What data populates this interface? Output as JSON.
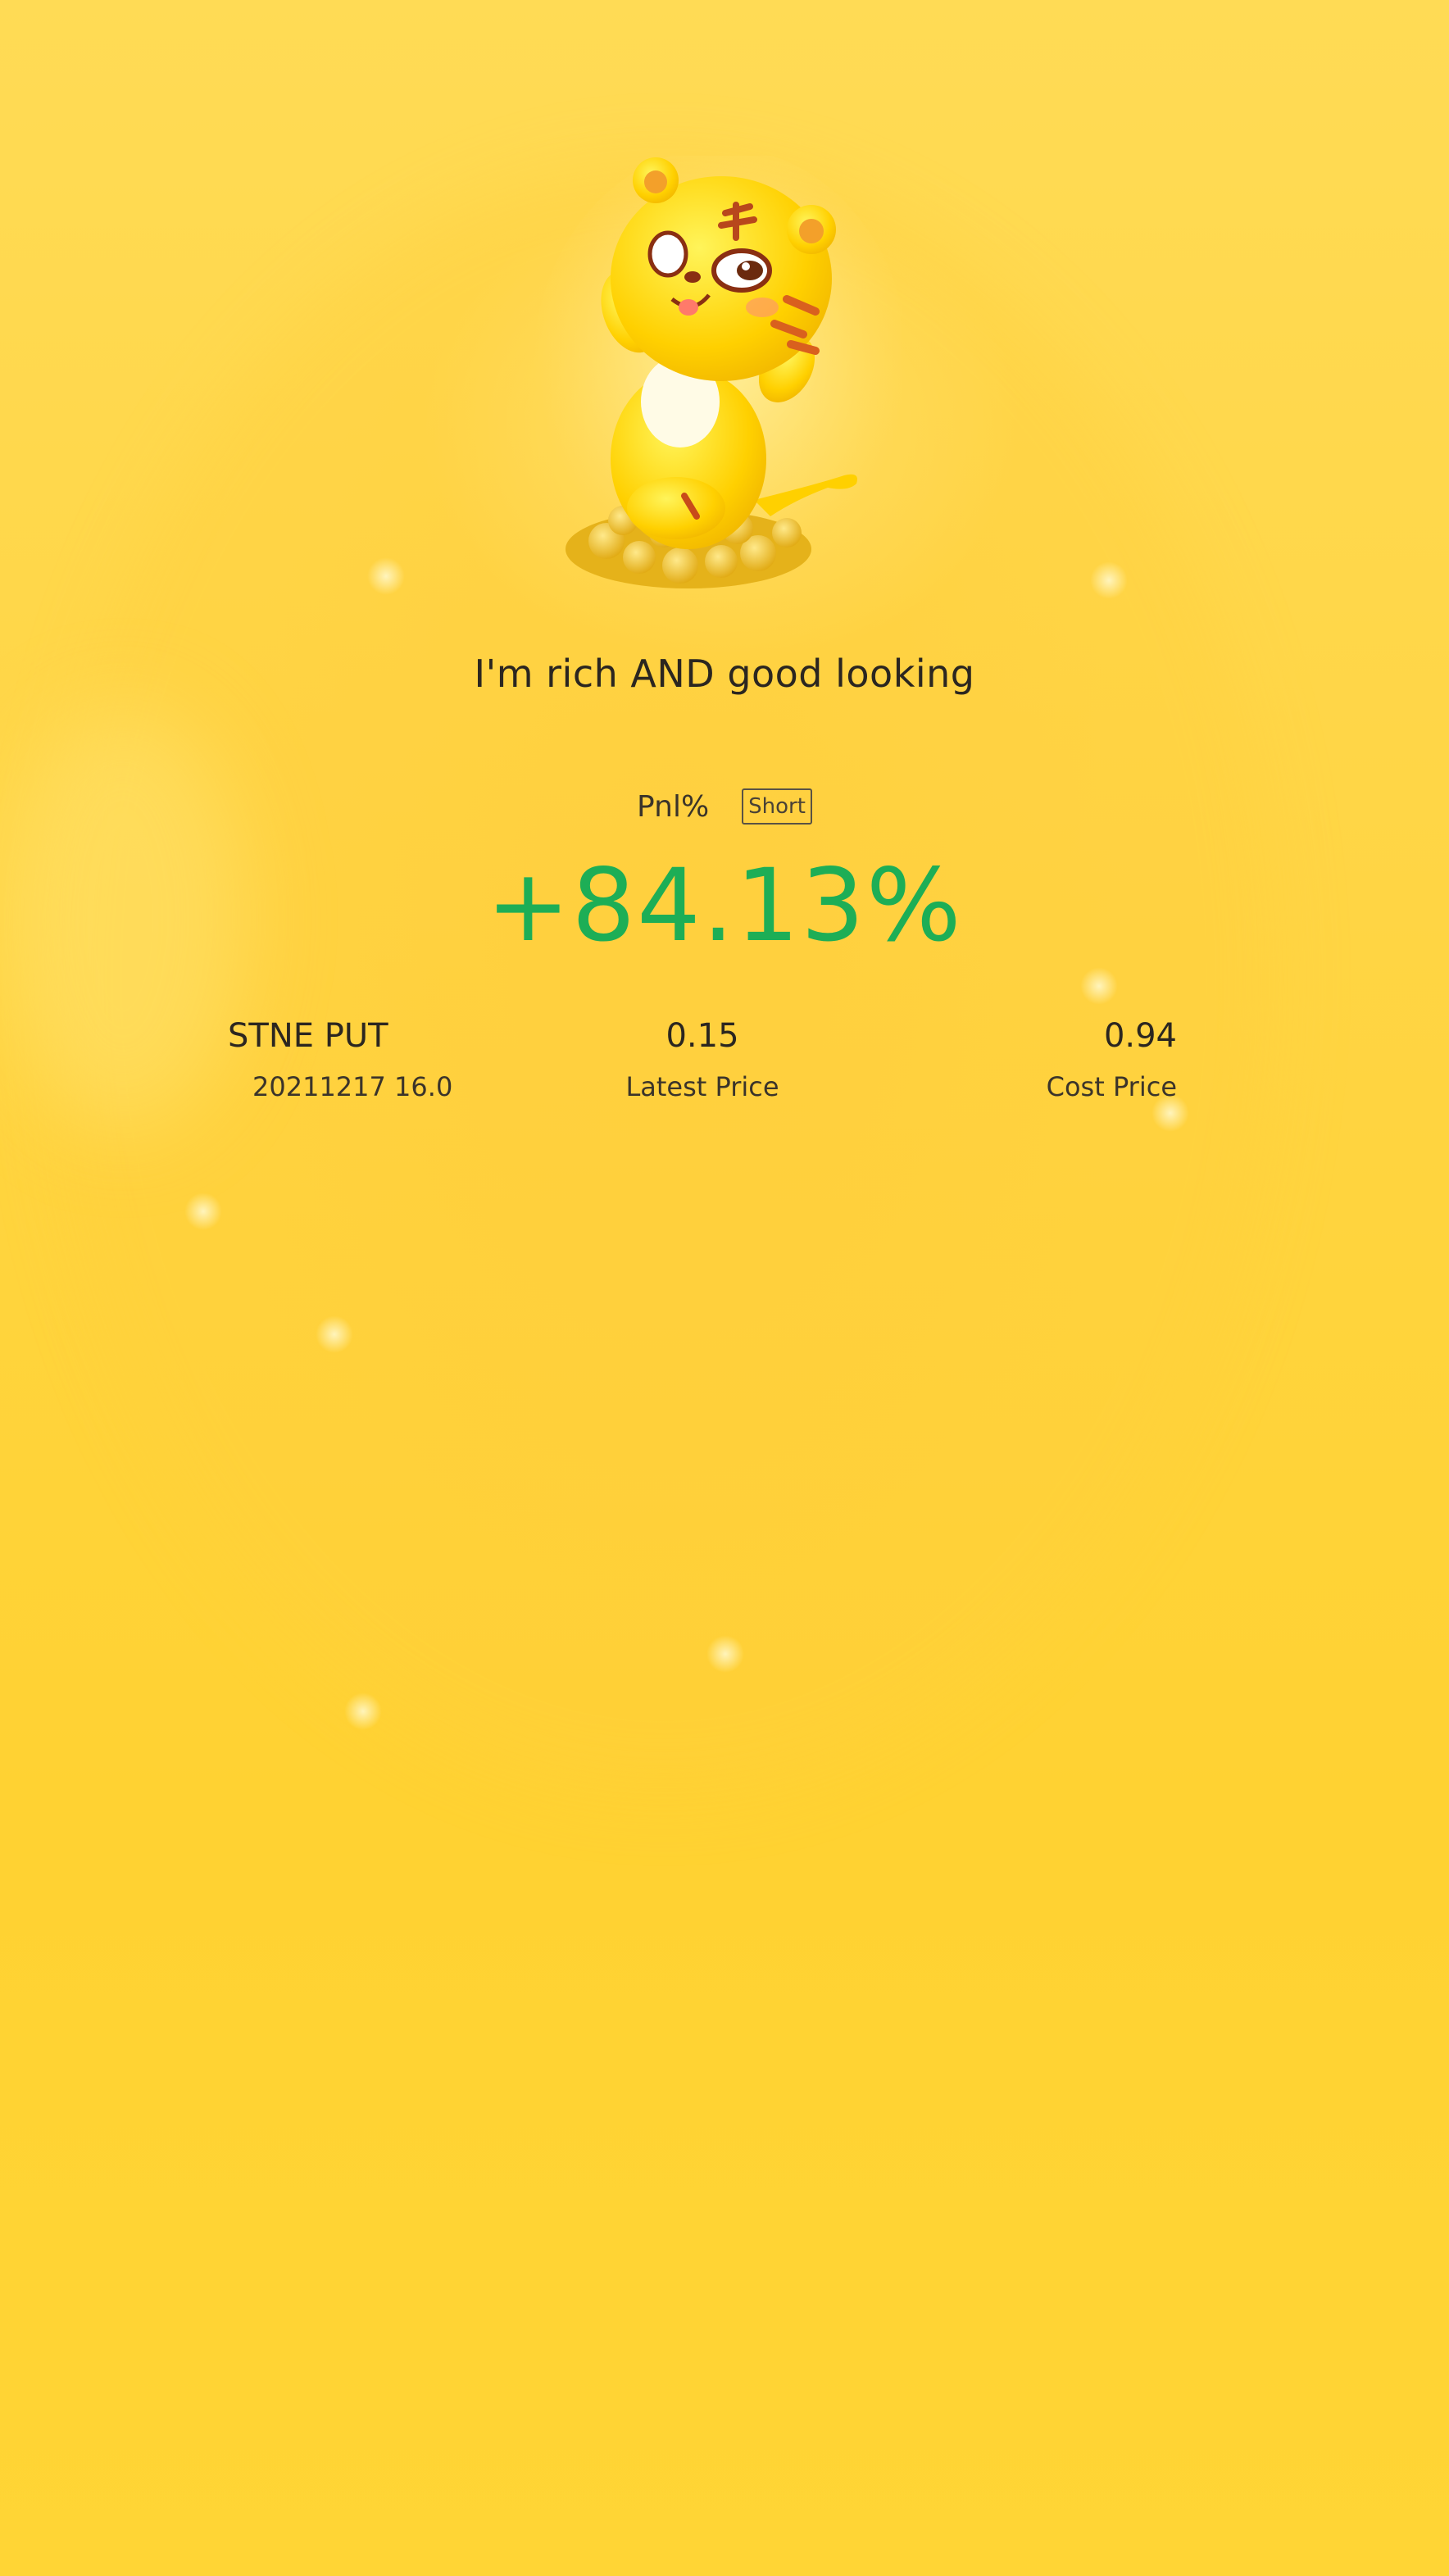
{
  "mascot": {
    "icon": "tiger-mascot-icon"
  },
  "tagline": "I'm rich AND good looking",
  "pnl": {
    "label": "Pnl%",
    "direction": "Short",
    "value": "+84.13%",
    "value_color": "#1dae56"
  },
  "position": {
    "symbol": "STNE PUT",
    "contract": "20211217 16.0",
    "latest_price": "0.15",
    "latest_price_label": "Latest Price",
    "cost_price": "0.94",
    "cost_price_label": "Cost Price"
  },
  "colors": {
    "background": "#ffd83a",
    "text": "#2b2620",
    "positive": "#1dae56"
  }
}
